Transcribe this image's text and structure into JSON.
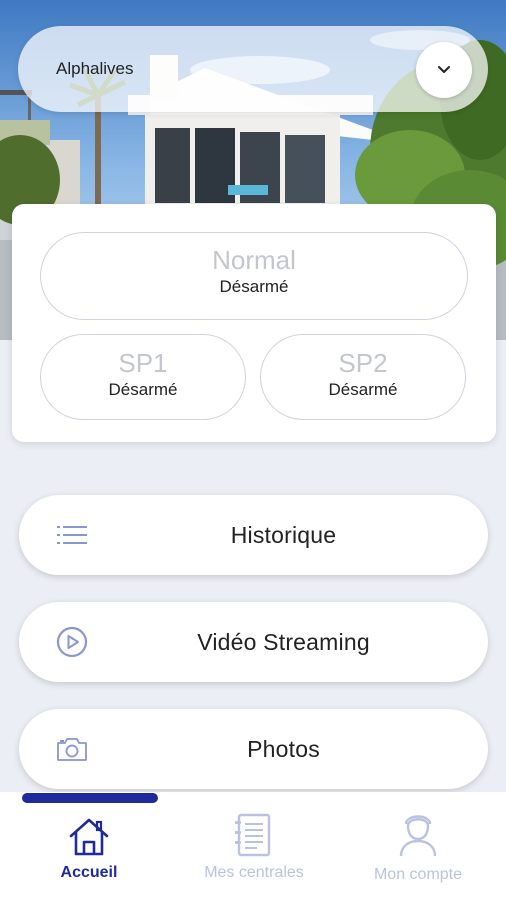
{
  "header": {
    "site_name": "Alphalives",
    "dropdown_icon": "chevron-down-icon"
  },
  "modes": {
    "normal": {
      "title": "Normal",
      "state": "Désarmé"
    },
    "sp1": {
      "title": "SP1",
      "state": "Désarmé"
    },
    "sp2": {
      "title": "SP2",
      "state": "Désarmé"
    }
  },
  "actions": [
    {
      "label": "Historique",
      "icon": "list-icon"
    },
    {
      "label": "Vidéo Streaming",
      "icon": "play-circle-icon"
    },
    {
      "label": "Photos",
      "icon": "camera-icon"
    }
  ],
  "nav": {
    "items": [
      {
        "label": "Accueil",
        "icon": "home-icon",
        "active": true
      },
      {
        "label": "Mes centrales",
        "icon": "document-icon",
        "active": false
      },
      {
        "label": "Mon compte",
        "icon": "user-icon",
        "active": false
      }
    ]
  },
  "colors": {
    "accent": "#1f2a9c",
    "inactive_nav": "#b9c2e2",
    "icon_blue": "#8a95d4",
    "mode_title": "#c3c6cf",
    "background": "#eceef5"
  }
}
